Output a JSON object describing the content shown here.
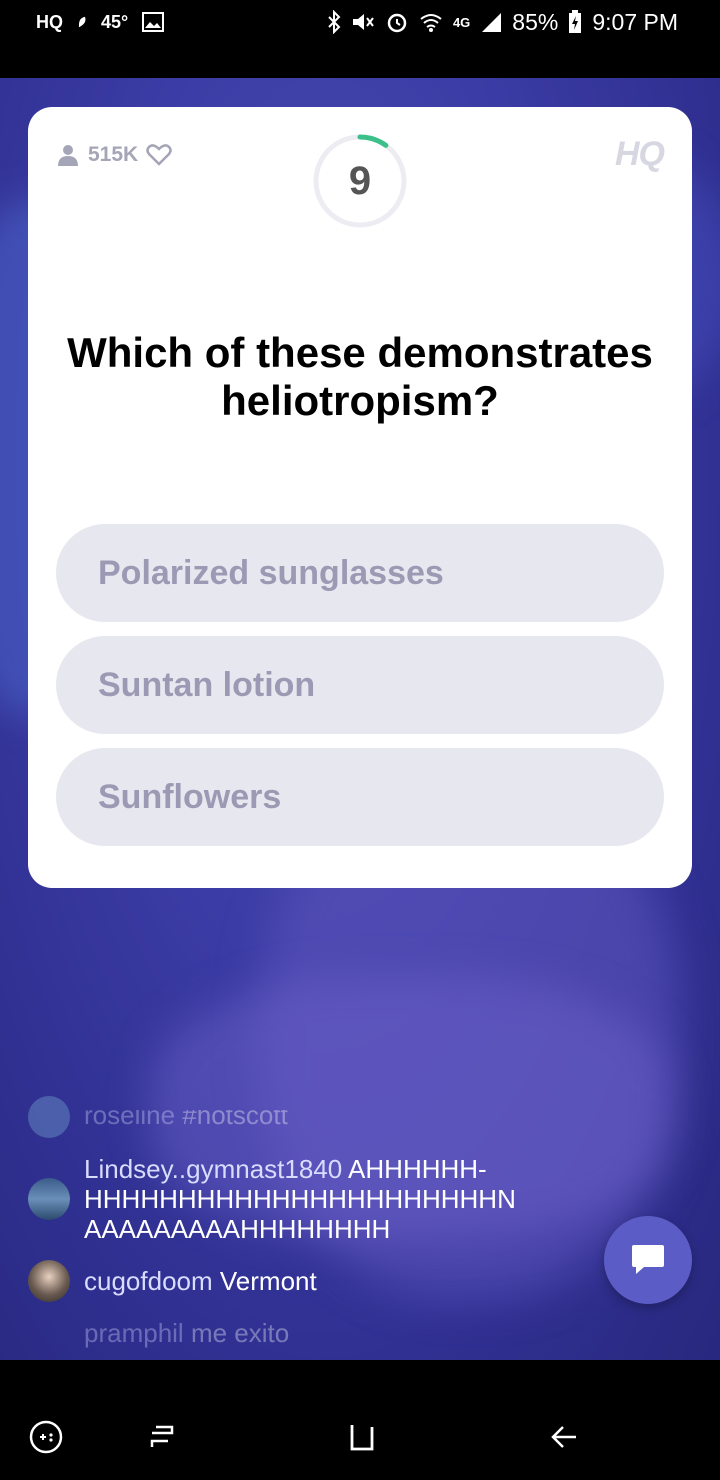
{
  "status_bar": {
    "app_label": "HQ",
    "temperature": "45°",
    "network": "4G",
    "battery": "85%",
    "time": "9:07 PM"
  },
  "card": {
    "viewer_count": "515K",
    "logo": "HQ",
    "timer": "9",
    "timer_progress": 0.1,
    "question": "Which of these demonstrates heliotropism?",
    "answers": [
      {
        "label": "Polarized sunglasses"
      },
      {
        "label": "Suntan lotion"
      },
      {
        "label": "Sunflowers"
      }
    ]
  },
  "chat": {
    "messages": [
      {
        "user": "roseline",
        "text": "#hotscott"
      },
      {
        "user": "Lindsey..gymnast1840",
        "text": "AHHHHHH-",
        "text_line2": "HHHHHHHHHHHHHHHHHHHHHHN",
        "text_line3": "AAAAAAAAAHHHHHHHH"
      },
      {
        "user": "cugofdoom",
        "text": "Vermont"
      },
      {
        "user": "pramphil",
        "text": "me exito"
      }
    ]
  },
  "colors": {
    "accent": "#5c5cc6",
    "timer_green": "#3cc08a",
    "answer_bg": "#e7e7ef",
    "answer_text": "#9a9ab4"
  }
}
